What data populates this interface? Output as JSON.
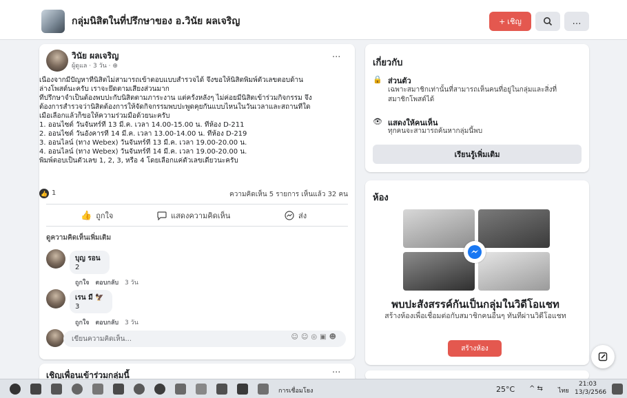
{
  "header": {
    "group_name": "กลุ่มนิสิตในที่ปรึกษาของ อ.วินัย ผลเจริญ",
    "invite_label": "เชิญ",
    "invite_icon": "+",
    "search_icon": "search-icon",
    "more_label": "…"
  },
  "post": {
    "author": "วินัย ผลเจริญ",
    "meta": "ผู้ดูแล · 3 วัน · ⊕",
    "more": "···",
    "lines": [
      "เนื่องจากมีปัญหาที่นิสิตไม่สามารถเข้าตอบแบบสำรวจได้ จึงขอให้นิสิตพิมพ์ตัวเลขตอบด้าน",
      "ล่างโพสต์นะครับ เราจะยึดตามเสียงส่วนมาก",
      "ที่ปรึกษาจำเป็นต้องพบปะกับนิสิตตามภาระงาน แต่ครั้งหลังๆ ไม่ค่อยมีนิสิตเข้าร่วมกิจกรรม จึง",
      "ต้องการสำรวจว่านิสิตต้องการให้จัดกิจกรรมพบปะพูดคุยกันแบบไหนในวันเวลาและสถานที่ใด",
      "เมื่อเลือกแล้วก็ขอให้ความร่วมมือด้วยนะครับ",
      "1. ออนไซต์ วันจันทร์ที่ 13 มี.ค. เวลา 14.00-15.00 น. ที่ห้อง D-211",
      "2. ออนไซต์ วันอังคารที่ 14 มี.ค. เวลา 13.00-14.00 น. ที่ห้อง D-219",
      "3. ออนไลน์ (ทาง Webex) วันจันทร์ที่ 13 มี.ค. เวลา 19.00-20.00 น.",
      "4. ออนไลน์ (ทาง Webex) วันจันทร์ที่ 14 มี.ค. เวลา 19.00-20.00 น.",
      "พิมพ์ตอบเป็นตัวเลข 1, 2, 3, หรือ 4 โดยเลือกแค่ตัวเลขเดียวนะครับ"
    ],
    "reaction_count": "1",
    "stats": "ความคิดเห็น 5 รายการ  เห็นแล้ว 32 คน",
    "like_label": "ถูกใจ",
    "comment_label": "แสดงความคิดเห็น",
    "share_label": "ส่ง",
    "view_more": "ดูความคิดเห็นเพิ่มเติม",
    "comments": [
      {
        "name": "บุญ รอน",
        "text": "2",
        "like": "ถูกใจ",
        "reply": "ตอบกลับ",
        "time": "3 วัน"
      },
      {
        "name": "เรน มี",
        "text": "3",
        "like": "ถูกใจ",
        "reply": "ตอบกลับ",
        "time": "3 วัน"
      }
    ],
    "composer_placeholder": "เขียนความคิดเห็น..."
  },
  "next_card": {
    "title": "เชิญเพื่อนเข้าร่วมกลุ่มนี้",
    "more": "···"
  },
  "about": {
    "title": "เกี่ยวกับ",
    "private_title": "ส่วนตัว",
    "private_desc_1": "เฉพาะสมาชิกเท่านั้นที่สามารถเห็นคนที่อยู่ในกลุ่มและสิ่งที่",
    "private_desc_2": "สมาชิกโพสต์ได้",
    "visible_title": "แสดงให้คนเห็น",
    "visible_desc": "ทุกคนจะสามารถค้นหากลุ่มนี้พบ",
    "learn_more": "เรียนรู้เพิ่มเติม"
  },
  "rooms": {
    "title": "ห้อง",
    "heading": "พบปะสังสรรค์กันเป็นกลุ่มในวิดีโอแชท",
    "sub": "สร้างห้องเพื่อเชื่อมต่อกับสมาชิกคนอื่นๆ ทันทีผ่านวิดีโอแชท",
    "create": "สร้างห้อง"
  },
  "taskbar": {
    "app_label": "การเชื่อมโยง",
    "weather": "25°C",
    "lang": "ไทย",
    "time": "21:03",
    "date": "13/3/2566"
  },
  "colors": {
    "brand": "#e4584f",
    "page_bg": "#f0f2f5",
    "messenger": "#1877f2"
  }
}
